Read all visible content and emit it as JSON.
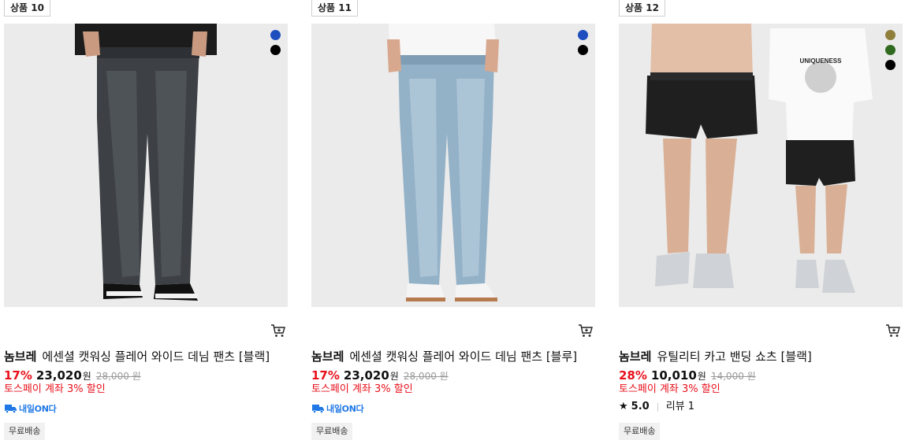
{
  "products": [
    {
      "badge": "상품 10",
      "brand": "놈브레",
      "name": "에센셜 캣워싱 플레어 와이드 데님 팬츠 [블랙]",
      "discount": "17%",
      "price": "23,020",
      "currency": "원",
      "original_price": "28,000 원",
      "promo": "토스페이 계좌 3% 할인",
      "delivery_label": "내일ON다",
      "shipping": "무료배송",
      "swatches": [
        "#1f4fbf",
        "#000000"
      ]
    },
    {
      "badge": "상품 11",
      "brand": "놈브레",
      "name": "에센셜 캣워싱 플레어 와이드 데님 팬츠 [블루]",
      "discount": "17%",
      "price": "23,020",
      "currency": "원",
      "original_price": "28,000 원",
      "promo": "토스페이 계좌 3% 할인",
      "delivery_label": "내일ON다",
      "shipping": "무료배송",
      "swatches": [
        "#1f4fbf",
        "#000000"
      ]
    },
    {
      "badge": "상품 12",
      "brand": "놈브레",
      "name": "유틸리티 카고 밴딩 쇼츠 [블랙]",
      "discount": "28%",
      "price": "10,010",
      "currency": "원",
      "original_price": "14,000 원",
      "promo": "토스페이 계좌 3% 할인",
      "rating": "5.0",
      "reviews": "리뷰 1",
      "shipping": "무료배송",
      "tee_print": "UNIQUENESS",
      "swatches": [
        "#8f7f3b",
        "#2f6a1f",
        "#000000"
      ]
    }
  ],
  "colors": {
    "accent_red": "#e8111b",
    "delivery_blue": "#1f78e5"
  }
}
